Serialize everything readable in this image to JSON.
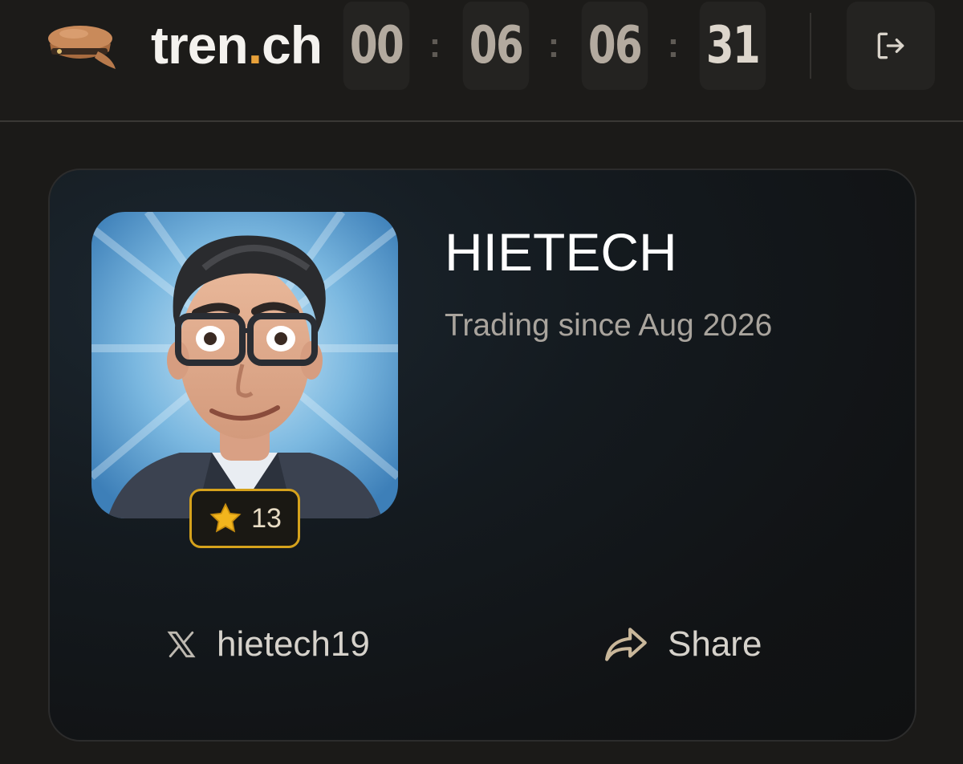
{
  "header": {
    "brand_prefix": "tren",
    "brand_dot": ".",
    "brand_suffix": "ch",
    "logo_icon": "captain-hat-icon",
    "accent_color": "#e8a13a",
    "timer": [
      "00",
      "06",
      "06",
      "31"
    ],
    "timer_separator": ":",
    "logout_icon": "logout-icon"
  },
  "profile": {
    "name": "HIETECH",
    "since": "Trading since Aug 2026",
    "badge": {
      "icon": "star-icon",
      "count": "13",
      "color": "#d6a21c"
    },
    "social": {
      "icon": "x-logo-icon",
      "handle": "hietech19"
    },
    "share": {
      "icon": "share-arrow-icon",
      "label": "Share"
    }
  }
}
